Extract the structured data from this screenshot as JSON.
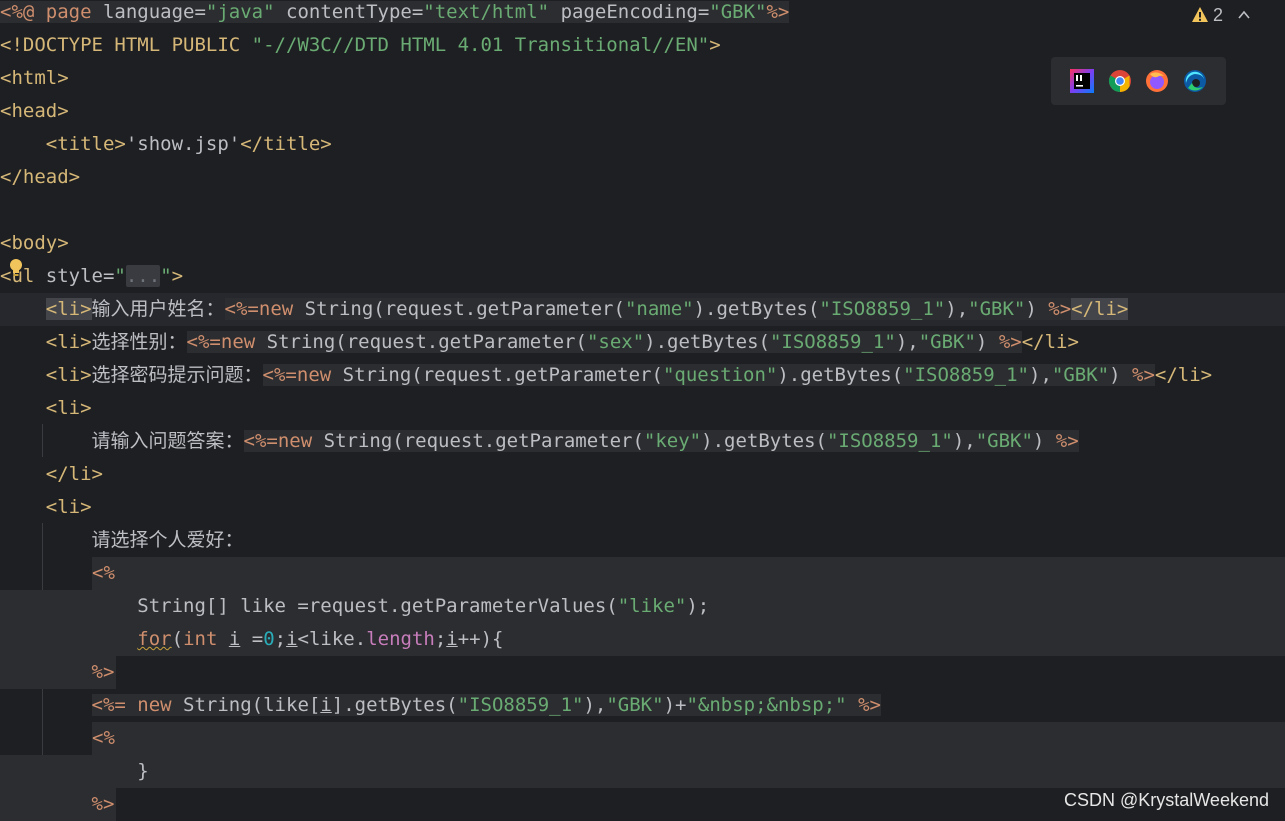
{
  "editor": {
    "lines": {
      "l1": {
        "open": "<%@",
        "kw": " page",
        "a1": " language=",
        "v1": "\"java\"",
        "a2": " contentType=",
        "v2": "\"text/html\"",
        "a3": " pageEncoding=",
        "v3": "\"GBK\"",
        "close": "%>"
      },
      "l2": {
        "t": "<!DOCTYPE HTML PUBLIC ",
        "s": "\"-//W3C//DTD HTML 4.01 Transitional//EN\"",
        "c": ">"
      },
      "l3": {
        "t": "<html>"
      },
      "l4": {
        "t": "<head>"
      },
      "l5": {
        "o": "<title>",
        "txt": "'show.jsp'",
        "c": "</title>"
      },
      "l6": {
        "t": "</head>"
      },
      "l8": {
        "t": "<body>"
      },
      "l9": {
        "o": "<ul",
        "a": " style=",
        "q1": "\"",
        "fold": "...",
        "q2": "\"",
        "c": ">"
      },
      "l10": {
        "o": "<li>",
        "label": "输入用户姓名：",
        "d1": "<%=",
        "kw": "new",
        "p1": " String(request.getParameter(",
        "s1": "\"name\"",
        "p2": ").getBytes(",
        "s2": "\"ISO8859_1\"",
        "p3": "),",
        "s3": "\"GBK\"",
        "p4": ") ",
        "d2": "%>",
        "c": "</li>"
      },
      "l11": {
        "o": "<li>",
        "label": "选择性别：",
        "d1": "<%=",
        "kw": "new",
        "p1": " String(request.getParameter(",
        "s1": "\"sex\"",
        "p2": ").getBytes(",
        "s2": "\"ISO8859_1\"",
        "p3": "),",
        "s3": "\"GBK\"",
        "p4": ") ",
        "d2": "%>",
        "c": "</li>"
      },
      "l12": {
        "o": "<li>",
        "label": "选择密码提示问题：",
        "d1": "<%=",
        "kw": "new",
        "p1": " String(request.getParameter(",
        "s1": "\"question\"",
        "p2": ").getBytes(",
        "s2": "\"ISO8859_1\"",
        "p3": "),",
        "s3": "\"GBK\"",
        "p4": ") ",
        "d2": "%>",
        "c": "</li>"
      },
      "l13": {
        "t": "<li>"
      },
      "l14": {
        "label": "请输入问题答案：",
        "d1": "<%=",
        "kw": "new",
        "p1": " String(request.getParameter(",
        "s1": "\"key\"",
        "p2": ").getBytes(",
        "s2": "\"ISO8859_1\"",
        "p3": "),",
        "s3": "\"GBK\"",
        "p4": ") ",
        "d2": "%>"
      },
      "l15": {
        "t": "</li>"
      },
      "l16": {
        "t": "<li>"
      },
      "l17": {
        "label": "请选择个人爱好："
      },
      "l18": {
        "d": "<%"
      },
      "l19": {
        "p1": "String[] like =request.getParameterValues(",
        "s1": "\"like\"",
        "p2": ");"
      },
      "l20": {
        "kw1": "for",
        "p0": "(",
        "kw2": "int",
        "sp": " ",
        "v1": "i",
        "p1": " =",
        "n": "0",
        "p2": ";",
        "v2": "i",
        "p3": "<like.",
        "f": "length",
        "p4": ";",
        "v3": "i",
        "p5": "++){"
      },
      "l21": {
        "d": "%>"
      },
      "l22": {
        "d1": "<%=",
        "kw": " new",
        "p1": " String(like[",
        "v": "i",
        "p2": "].getBytes(",
        "s1": "\"ISO8859_1\"",
        "p3": "),",
        "s2": "\"GBK\"",
        "p4": ")+",
        "s3": "\"&nbsp;&nbsp;\"",
        "sp": " ",
        "d2": "%>"
      },
      "l23": {
        "d": "<%"
      },
      "l24": {
        "t": "}"
      },
      "l25": {
        "d": "%>"
      }
    }
  },
  "inspection": {
    "count": "2",
    "icon": "warning-icon"
  },
  "browsers": [
    {
      "name": "IntelliJ",
      "icon": "intellij-icon"
    },
    {
      "name": "Chrome",
      "icon": "chrome-icon"
    },
    {
      "name": "Firefox",
      "icon": "firefox-icon"
    },
    {
      "name": "Edge",
      "icon": "edge-icon"
    }
  ],
  "watermark": "CSDN @KrystalWeekend",
  "colors": {
    "background": "#1e1f22",
    "tag": "#d5b778",
    "string": "#6aab73",
    "keyword": "#cf8e6d",
    "number": "#2aacb8",
    "field": "#c77dbb"
  }
}
